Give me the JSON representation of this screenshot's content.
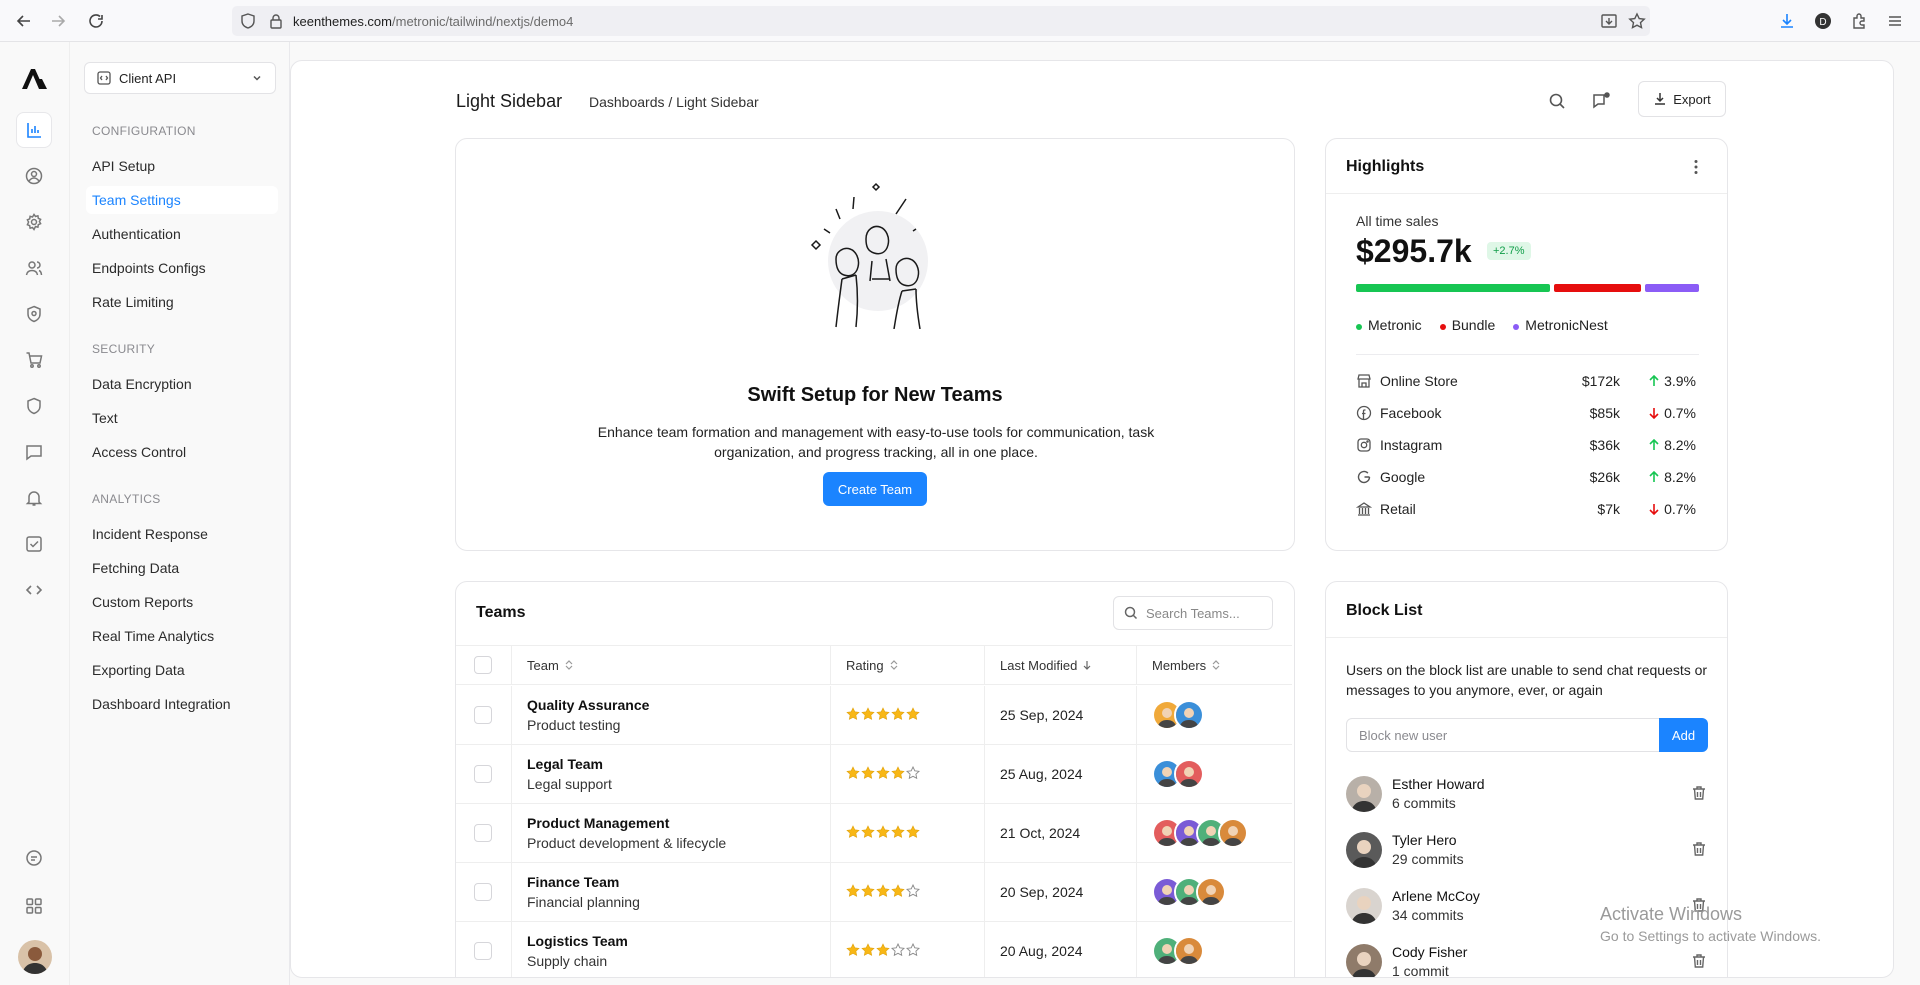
{
  "browser": {
    "url_domain": "keenthemes.com",
    "url_path": "/metronic/tailwind/nextjs/demo4"
  },
  "rail": {
    "icons": [
      "logo-icon",
      "chart-icon",
      "user-circle-icon",
      "gear-icon",
      "users-icon",
      "shield-badge-icon",
      "cart-icon",
      "shield-icon",
      "message-icon",
      "bell-icon",
      "check-square-icon",
      "code-icon",
      "chat-icon",
      "grid-icon",
      "avatar"
    ]
  },
  "sidebar": {
    "select_label": "Client API",
    "sections": [
      {
        "title": "CONFIGURATION",
        "items": [
          "API Setup",
          "Team Settings",
          "Authentication",
          "Endpoints Configs",
          "Rate Limiting"
        ]
      },
      {
        "title": "SECURITY",
        "items": [
          "Data Encryption",
          "Text",
          "Access Control"
        ]
      },
      {
        "title": "ANALYTICS",
        "items": [
          "Incident Response",
          "Fetching Data",
          "Custom Reports",
          "Real Time Analytics",
          "Exporting Data",
          "Dashboard Integration"
        ]
      }
    ],
    "active_item": "Team Settings"
  },
  "header": {
    "title": "Light Sidebar",
    "breadcrumb": "Dashboards / Light Sidebar",
    "export_label": "Export"
  },
  "hero": {
    "title": "Swift Setup for New Teams",
    "description": "Enhance team formation and management with easy-to-use tools for communication, task organization, and progress tracking, all in one place.",
    "button": "Create Team"
  },
  "highlights": {
    "title": "Highlights",
    "label": "All time sales",
    "value": "$295.7k",
    "badge": "+2.7%",
    "legend": [
      {
        "name": "Metronic",
        "color": "#17c653",
        "share": 0.58
      },
      {
        "name": "Bundle",
        "color": "#e60e0e",
        "share": 0.26
      },
      {
        "name": "MetronicNest",
        "color": "#8b5cf6",
        "share": 0.16
      }
    ],
    "rows": [
      {
        "icon": "store-icon",
        "name": "Online Store",
        "amount": "$172k",
        "change": "3.9%",
        "dir": "up"
      },
      {
        "icon": "facebook-icon",
        "name": "Facebook",
        "amount": "$85k",
        "change": "0.7%",
        "dir": "down"
      },
      {
        "icon": "instagram-icon",
        "name": "Instagram",
        "amount": "$36k",
        "change": "8.2%",
        "dir": "up"
      },
      {
        "icon": "google-icon",
        "name": "Google",
        "amount": "$26k",
        "change": "8.2%",
        "dir": "up"
      },
      {
        "icon": "bank-icon",
        "name": "Retail",
        "amount": "$7k",
        "change": "0.7%",
        "dir": "down"
      }
    ]
  },
  "teams": {
    "title": "Teams",
    "search_placeholder": "Search Teams...",
    "columns": [
      "Team",
      "Rating",
      "Last Modified",
      "Members"
    ],
    "rows": [
      {
        "name": "Quality Assurance",
        "desc": "Product testing",
        "rating": 5,
        "date": "25 Sep, 2024",
        "members": 2
      },
      {
        "name": "Legal Team",
        "desc": "Legal support",
        "rating": 4,
        "date": "25 Aug, 2024",
        "members": 2
      },
      {
        "name": "Product Management",
        "desc": "Product development & lifecycle",
        "rating": 5,
        "date": "21 Oct, 2024",
        "members": 4
      },
      {
        "name": "Finance Team",
        "desc": "Financial planning",
        "rating": 4,
        "date": "20 Sep, 2024",
        "members": 3
      },
      {
        "name": "Logistics Team",
        "desc": "Supply chain",
        "rating": 3,
        "date": "20 Aug, 2024",
        "members": 2
      }
    ]
  },
  "blocklist": {
    "title": "Block List",
    "description": "Users on the block list are unable to send chat requests or messages to you anymore, ever, or again",
    "input_placeholder": "Block new user",
    "add_label": "Add",
    "users": [
      {
        "name": "Esther Howard",
        "commits": "6 commits"
      },
      {
        "name": "Tyler Hero",
        "commits": "29 commits"
      },
      {
        "name": "Arlene McCoy",
        "commits": "34 commits"
      },
      {
        "name": "Cody Fisher",
        "commits": "1 commit"
      }
    ]
  },
  "watermark": {
    "line1": "Activate Windows",
    "line2": "Go to Settings to activate Windows."
  }
}
